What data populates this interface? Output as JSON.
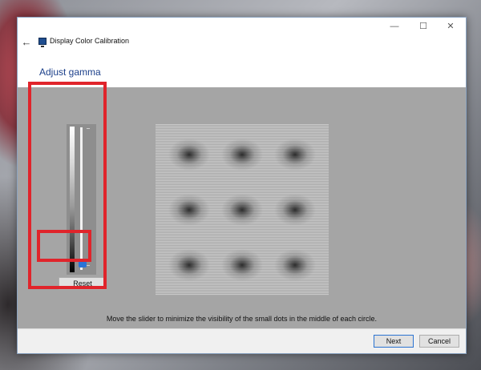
{
  "window": {
    "title": "Display Color Calibration",
    "back_icon": "←",
    "min_icon": "—",
    "max_icon": "☐",
    "close_icon": "✕"
  },
  "page": {
    "heading": "Adjust gamma",
    "instruction": "Move the slider to minimize the visibility of the small dots in the middle of each circle."
  },
  "slider": {
    "value_fraction": 0.02,
    "reset_label": "Reset"
  },
  "footer": {
    "next_label": "Next",
    "cancel_label": "Cancel"
  },
  "colors": {
    "highlight": "#e0242b",
    "accent": "#2a73d6",
    "heading": "#1b3f8a"
  }
}
